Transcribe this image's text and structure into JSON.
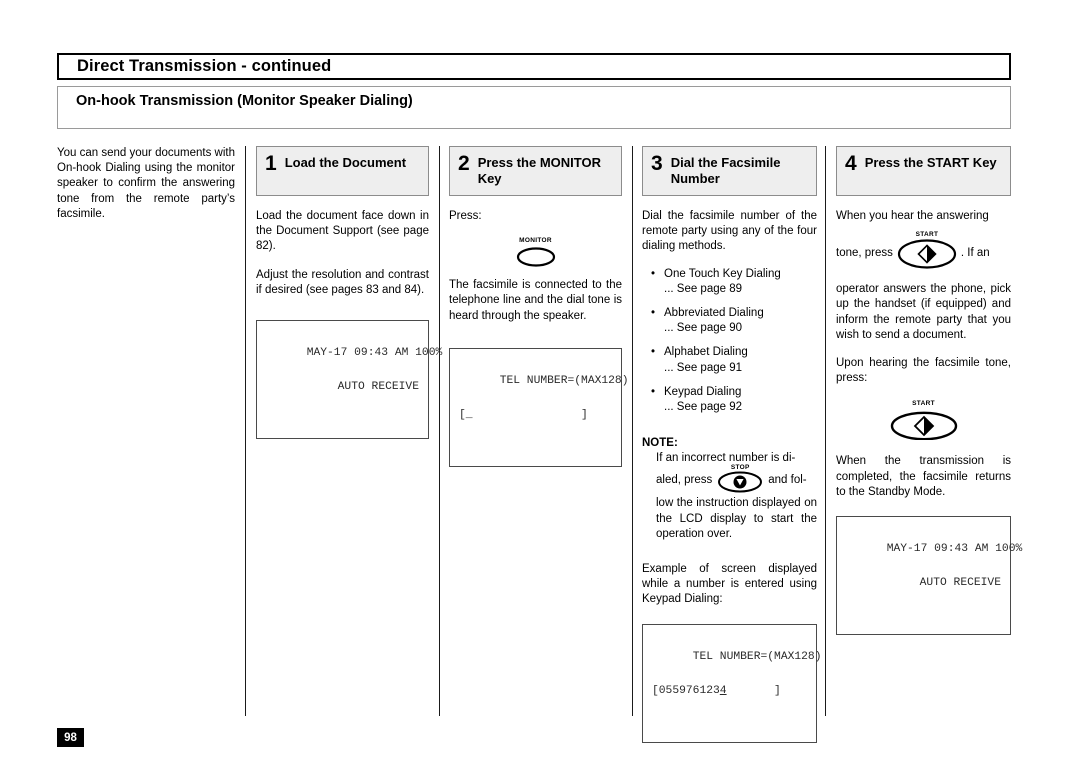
{
  "header": {
    "title": "Direct Transmission - continued",
    "subtitle": "On-hook Transmission (Monitor Speaker Dialing)"
  },
  "intro": {
    "text": "You can send your documents with On-hook Dialing using the monitor speaker to confirm the answering tone from the remote party’s facsimile."
  },
  "steps": [
    {
      "number": "1",
      "title": "Load the Document",
      "para1": "Load the document face down in the Document Support (see page 82).",
      "para2": "Adjust the resolution and contrast if desired (see pages 83 and 84).",
      "lcd": {
        "line1": "MAY-17 09:43 AM 100%",
        "line2": "AUTO RECEIVE"
      }
    },
    {
      "number": "2",
      "title": "Press the MONITOR Key",
      "press_label": "Press:",
      "key_name": "MONITOR",
      "para1": "The facsimile is connected to the telephone line and the dial tone is heard through the speaker.",
      "lcd": {
        "line1": "TEL NUMBER=(MAX128)",
        "line2": "[_                ]"
      }
    },
    {
      "number": "3",
      "title": "Dial the Facsimile Number",
      "para1": "Dial the facsimile number of the remote party using any of the four dialing methods.",
      "bullets": [
        {
          "name": "One Touch Key Dialing",
          "ref": "... See page 89"
        },
        {
          "name": "Abbreviated Dialing",
          "ref": "... See page 90"
        },
        {
          "name": "Alphabet Dialing",
          "ref": "... See page 91"
        },
        {
          "name": "Keypad Dialing",
          "ref": "... See page 92"
        }
      ],
      "note_label": "NOTE:",
      "note_part1": "If an incorrect number is di-",
      "note_part2": "aled, press",
      "note_key": "STOP",
      "note_part3": "and fol-",
      "note_part4": "low the instruction displayed on the LCD display to start the operation over.",
      "para2": "Example of screen displayed while a number is entered using Keypad Dialing:",
      "lcd": {
        "line1": "TEL NUMBER=(MAX128)",
        "line2_pre": "[055976123",
        "line2_cursor": "4",
        "line2_post": "       ]"
      }
    },
    {
      "number": "4",
      "title": "Press the START Key",
      "para1": "When you hear the answering",
      "inline_pre": "tone, press",
      "key_name": "START",
      "inline_post": ". If an",
      "para2": "operator answers the phone, pick up the handset (if equipped) and inform the remote party that you wish to send a document.",
      "para3": "Upon hearing the facsimile tone, press:",
      "para4": "When the transmission is completed, the facsimile returns to the Standby Mode.",
      "lcd": {
        "line1": "MAY-17 09:43 AM 100%",
        "line2": "AUTO RECEIVE"
      }
    }
  ],
  "footer": {
    "page_number": "98"
  }
}
